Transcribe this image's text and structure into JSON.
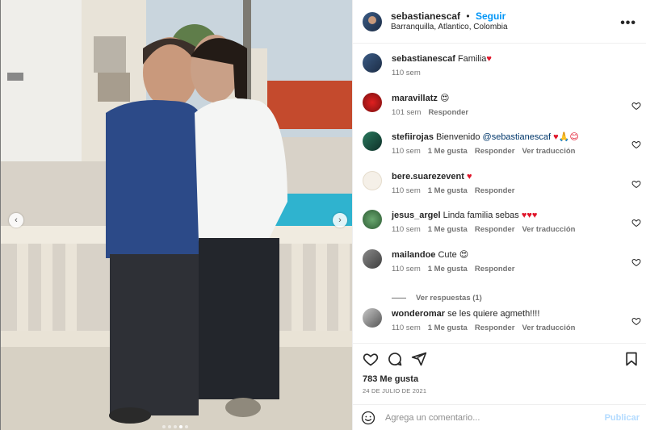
{
  "post": {
    "author": "sebastianescaf",
    "separator": "•",
    "follow_label": "Seguir",
    "location": "Barranquilla, Atlantico, Colombia",
    "more_label": "•••"
  },
  "caption": {
    "user": "sebastianescaf",
    "text": "Familia",
    "emoji": "♥",
    "time": "110 sem"
  },
  "comments": [
    {
      "user": "maravillatz",
      "text": "",
      "emoji": "😍",
      "time": "101 sem",
      "likes": "",
      "reply": "Responder",
      "translate": ""
    },
    {
      "user": "stefiirojas",
      "text": "Bienvenido",
      "mention": "@sebastianescaf",
      "emoji": "♥🙏😊",
      "time": "110 sem",
      "likes": "1 Me gusta",
      "reply": "Responder",
      "translate": "Ver traducción"
    },
    {
      "user": "bere.suarezevent",
      "text": "",
      "emoji": "♥",
      "time": "110 sem",
      "likes": "1 Me gusta",
      "reply": "Responder",
      "translate": ""
    },
    {
      "user": "jesus_argel",
      "text": "Linda familia sebas",
      "emoji": "♥♥♥",
      "time": "110 sem",
      "likes": "1 Me gusta",
      "reply": "Responder",
      "translate": "Ver traducción"
    },
    {
      "user": "mailandoe",
      "text": "Cute",
      "emoji": "😍",
      "time": "110 sem",
      "likes": "1 Me gusta",
      "reply": "Responder",
      "translate": ""
    },
    {
      "user": "wonderomar",
      "text": "se les quiere agmeth!!!!",
      "emoji": "",
      "time": "110 sem",
      "likes": "1 Me gusta",
      "reply": "Responder",
      "translate": "Ver traducción"
    }
  ],
  "view_replies": "Ver respuestas (1)",
  "likes_count": "783 Me gusta",
  "date": "24 DE JULIO DE 2021",
  "add_comment": {
    "placeholder": "Agrega un comentario...",
    "post_label": "Publicar"
  },
  "colors": {
    "accent": "#0095f6",
    "heart": "#e0162b",
    "muted": "#737373"
  },
  "icons": [
    "more-icon",
    "heart-icon",
    "comment-icon",
    "share-icon",
    "save-icon",
    "emoji-icon",
    "chevron-left-icon",
    "chevron-right-icon"
  ]
}
